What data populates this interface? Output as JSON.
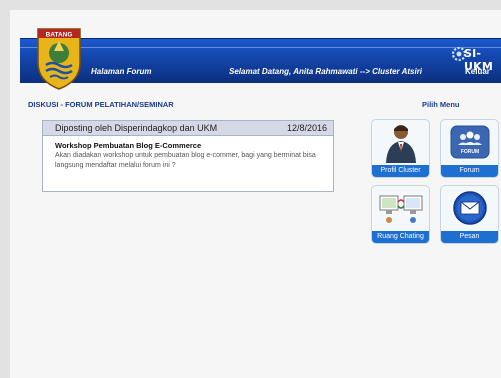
{
  "header": {
    "logo_text": "BATANG",
    "nav_title": "Halaman Forum",
    "welcome_prefix": "Selamat Datang,",
    "welcome_user": "Anita Rahmawati --> Cluster Atsiri",
    "logout": "Keluar",
    "brand": "SI-UKM"
  },
  "main": {
    "section_title": "DISKUSI - FORUM PELATIHAN/SEMINAR",
    "post": {
      "author": "Diposting oleh Disperindagkop dan UKM",
      "date": "12/8/2016",
      "title": "Workshop Pembuatan Blog E-Commerce",
      "body": "Akan diadakan workshop untuk pembuatan blog e-commer, bagi yang berminat bisa langsung mendaftar melalui forum ini ?"
    }
  },
  "menu": {
    "title": "Pilih Menu",
    "items": [
      {
        "label": "Profil Cluster",
        "icon": "profile-person-icon"
      },
      {
        "label": "Forum",
        "icon": "forum-icon",
        "icon_text": "FORUM"
      },
      {
        "label": "Ruang Chating",
        "icon": "chat-room-icon"
      },
      {
        "label": "Pesan",
        "icon": "envelope-icon"
      }
    ]
  },
  "colors": {
    "header_blue": "#1447ad",
    "tile_caption": "#1d6fd1",
    "section_title": "#1b3c8d"
  }
}
